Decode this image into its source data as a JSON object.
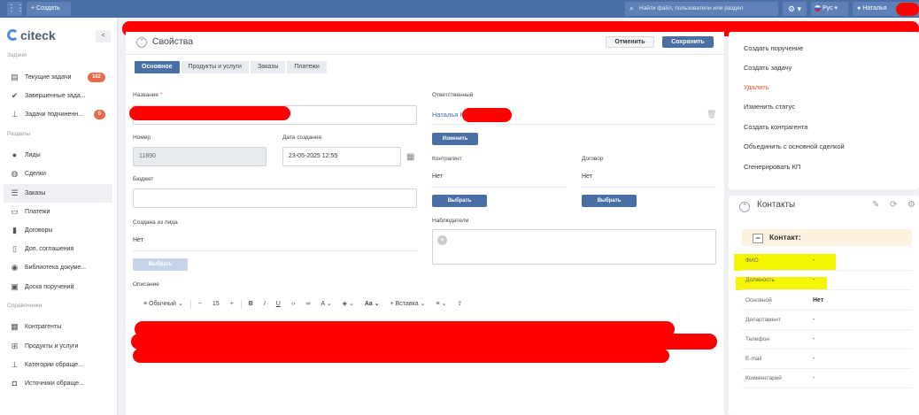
{
  "topbar": {
    "create_label": "+ Создать",
    "search_placeholder": "Найти файл, пользователи или раздел",
    "gear_label": "⚙ ▾",
    "lang_label": "Рус",
    "user_label": "Наталья"
  },
  "sidebar": {
    "logo_text": "citeck",
    "collapse_label": "<",
    "tasks_title": "Задачи",
    "tasks": [
      {
        "label": "Текущие задачи",
        "badge": "102"
      },
      {
        "label": "Завершенные зада..."
      },
      {
        "label": "Задачи подчиненн...",
        "badge": "0"
      }
    ],
    "sections_title": "Разделы",
    "sections": [
      {
        "label": "Лиды"
      },
      {
        "label": "Сделки"
      },
      {
        "label": "Заказы"
      },
      {
        "label": "Платежи"
      },
      {
        "label": "Договоры"
      },
      {
        "label": "Доп. соглашения"
      },
      {
        "label": "Библиотека докуме..."
      },
      {
        "label": "Доска поручений"
      }
    ],
    "refs_title": "Справочники",
    "refs": [
      {
        "label": "Контрагенты"
      },
      {
        "label": "Продукты и услуги"
      },
      {
        "label": "Категории обраще..."
      },
      {
        "label": "Источники обраще..."
      }
    ]
  },
  "main": {
    "title": "Свойства",
    "cancel_label": "Отменить",
    "save_label": "Сохранить",
    "tabs": [
      {
        "label": "Основное",
        "active": true
      },
      {
        "label": "Продукты и услуги"
      },
      {
        "label": "Заказы"
      },
      {
        "label": "Платежи"
      }
    ],
    "name_label": "Название",
    "required_mark": "*",
    "number_label": "Номер",
    "number_value": "11890",
    "created_label": "Дата создания",
    "created_value": "23-05-2025 12:55",
    "budget_label": "Бюджет",
    "from_lead_label": "Создана из лида",
    "from_lead_value": "Нет",
    "select_label": "Выбрать",
    "description_label": "Описание",
    "responsible_label": "Ответственный",
    "responsible_value": "Наталья К",
    "change_label": "Изменить",
    "counterparty_label": "Контрагент",
    "counterparty_value": "Нет",
    "contract_label": "Договор",
    "contract_value": "Нет",
    "observers_label": "Наблюдатели",
    "toolbar": {
      "style": "Обычный",
      "font_size": "15",
      "insert": "Вставка"
    }
  },
  "actions": [
    {
      "label": "Создать поручение"
    },
    {
      "label": "Создать задачу"
    },
    {
      "label": "Удалить",
      "danger": true
    },
    {
      "label": "Изменить статус"
    },
    {
      "label": "Создать контрагента"
    },
    {
      "label": "Объединить с основной сделкой"
    },
    {
      "label": "Сгенерировать КП"
    }
  ],
  "contacts": {
    "title": "Контакты",
    "section_title": "Контакт:",
    "rows": [
      {
        "key": "ФИО",
        "value": "-"
      },
      {
        "key": "Должность",
        "value": "-"
      },
      {
        "key": "Основной",
        "value": "Нет"
      },
      {
        "key": "Департамент",
        "value": "-"
      },
      {
        "key": "Телефон",
        "value": "-"
      },
      {
        "key": "E-mail",
        "value": "-"
      },
      {
        "key": "Комментарий",
        "value": "-"
      }
    ]
  },
  "colors": {
    "brand": "#4a6fa5",
    "badge": "#e9694c",
    "danger": "#e4532c",
    "highlight": "#f5f500",
    "redaction": "#ff0000"
  }
}
